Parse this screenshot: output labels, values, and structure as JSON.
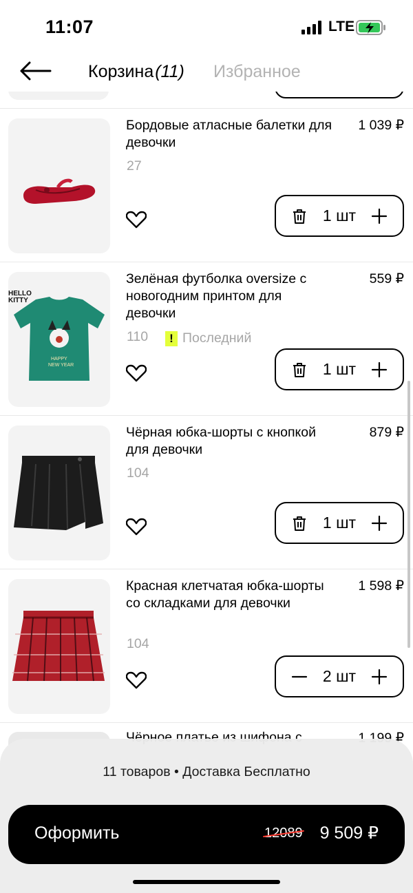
{
  "status_bar": {
    "time": "11:07",
    "network": "LTE"
  },
  "header": {
    "tab_cart_label": "Корзина",
    "tab_cart_count": "(11)",
    "tab_favorites_label": "Избранное"
  },
  "items": [
    {
      "title": "Бордовые атласные балетки для девочки",
      "price": "1 039 ₽",
      "size": "27",
      "badge": "",
      "qty": "1 шт",
      "left_control": "trash-icon"
    },
    {
      "title": "Зелёная футболка oversize с новогодним принтом для девочки",
      "price": "559 ₽",
      "size": "110",
      "badge": "Последний",
      "badge_mark": "!",
      "qty": "1 шт",
      "left_control": "trash-icon"
    },
    {
      "title": "Чёрная юбка-шорты с кнопкой для девочки",
      "price": "879 ₽",
      "size": "104",
      "badge": "",
      "qty": "1 шт",
      "left_control": "trash-icon"
    },
    {
      "title": "Красная клетчатая юбка-шорты со складками для девочки",
      "price": "1 598 ₽",
      "size": "104",
      "badge": "",
      "qty": "2 шт",
      "left_control": "minus-icon"
    }
  ],
  "next_item": {
    "title": "Чёрное платье из шифона с",
    "price": "1 199 ₽"
  },
  "summary": {
    "count_text": "11 товаров",
    "separator": "•",
    "delivery_text": "Доставка Бесплатно"
  },
  "checkout": {
    "label": "Оформить",
    "old_price": "12089",
    "new_price": "9 509 ₽"
  },
  "colors": {
    "accent_badge": "#e4ff3a",
    "button_bg": "#000000",
    "muted_text": "#a6a6a6",
    "strike": "#ff3b30"
  }
}
